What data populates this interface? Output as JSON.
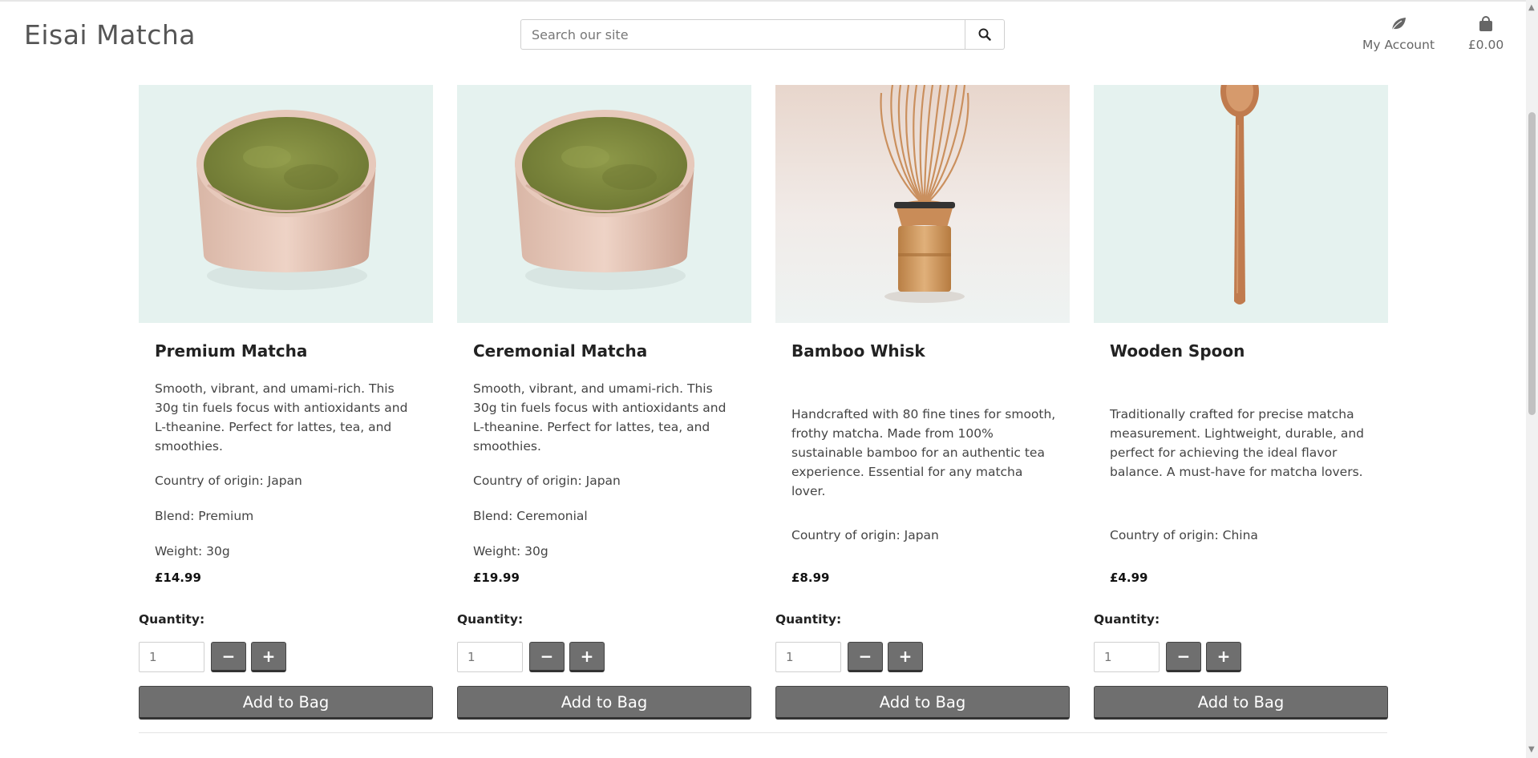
{
  "header": {
    "brand": "Eisai Matcha",
    "search_placeholder": "Search our site",
    "account_label": "My Account",
    "bag_total": "£0.00"
  },
  "icons": {
    "search": "search-icon",
    "account": "leaf-icon",
    "bag": "shopping-bag-icon"
  },
  "colors": {
    "button": "#6f6f6f",
    "image_background": "#e5f2ef",
    "matcha": "#7f8b3d",
    "bamboo": "#c98c58",
    "wood": "#c07b4e"
  },
  "products": [
    {
      "name": "Premium Matcha",
      "description": "Smooth, vibrant, and umami-rich. This 30g tin fuels focus with antioxidants and L-theanine. Perfect for lattes, tea, and smoothies.",
      "origin": "Country of origin: Japan",
      "blend": "Blend: Premium",
      "weight": "Weight: 30g",
      "price": "£14.99",
      "quantity_label": "Quantity:",
      "quantity": "1",
      "minus": "−",
      "plus": "+",
      "add_label": "Add to Bag",
      "image": "matcha-bowl"
    },
    {
      "name": "Ceremonial Matcha",
      "description": "Smooth, vibrant, and umami-rich. This 30g tin fuels focus with antioxidants and L-theanine. Perfect for lattes, tea, and smoothies.",
      "origin": "Country of origin: Japan",
      "blend": "Blend: Ceremonial",
      "weight": "Weight: 30g",
      "price": "£19.99",
      "quantity_label": "Quantity:",
      "quantity": "1",
      "minus": "−",
      "plus": "+",
      "add_label": "Add to Bag",
      "image": "matcha-bowl"
    },
    {
      "name": "Bamboo Whisk",
      "description": "Handcrafted with 80 fine tines for smooth, frothy matcha. Made from 100% sustainable bamboo for an authentic tea experience. Essential for any matcha lover.",
      "origin": "Country of origin: Japan",
      "price": "£8.99",
      "quantity_label": "Quantity:",
      "quantity": "1",
      "minus": "−",
      "plus": "+",
      "add_label": "Add to Bag",
      "image": "bamboo-whisk"
    },
    {
      "name": "Wooden Spoon",
      "description": "Traditionally crafted for precise matcha measurement. Lightweight, durable, and perfect for achieving the ideal flavor balance. A must-have for matcha lovers.",
      "origin": "Country of origin: China",
      "price": "£4.99",
      "quantity_label": "Quantity:",
      "quantity": "1",
      "minus": "−",
      "plus": "+",
      "add_label": "Add to Bag",
      "image": "wooden-spoon"
    }
  ]
}
